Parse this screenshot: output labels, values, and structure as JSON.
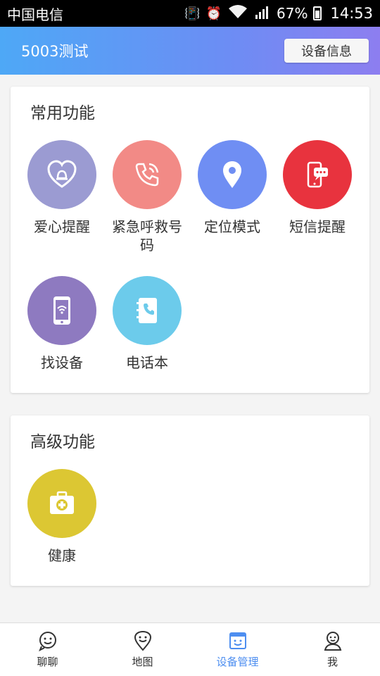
{
  "status_bar": {
    "carrier": "中国电信",
    "battery": "67%",
    "time": "14:53"
  },
  "app_bar": {
    "title": "5003测试",
    "device_info_button": "设备信息"
  },
  "common_section": {
    "title": "常用功能",
    "items": [
      {
        "label": "爱心提醒",
        "icon": "heart-bell-icon",
        "color": "#9b9bd2"
      },
      {
        "label": "紧急呼救号码",
        "icon": "phone-call-icon",
        "color": "#f28a86"
      },
      {
        "label": "定位模式",
        "icon": "location-pin-icon",
        "color": "#6f8ef3"
      },
      {
        "label": "短信提醒",
        "icon": "sms-phone-icon",
        "color": "#e8333e"
      },
      {
        "label": "找设备",
        "icon": "find-device-icon",
        "color": "#8e7ac0"
      },
      {
        "label": "电话本",
        "icon": "phonebook-icon",
        "color": "#6ccbeb"
      }
    ]
  },
  "advanced_section": {
    "title": "高级功能",
    "items": [
      {
        "label": "健康",
        "icon": "first-aid-kit-icon",
        "color": "#dcc733"
      }
    ]
  },
  "bottom_nav": {
    "items": [
      {
        "label": "聊聊",
        "icon": "chat-smile-icon"
      },
      {
        "label": "地图",
        "icon": "map-pin-smile-icon"
      },
      {
        "label": "设备管理",
        "icon": "device-manage-icon",
        "active": true
      },
      {
        "label": "我",
        "icon": "profile-icon"
      }
    ],
    "active_color": "#4d8ef0"
  }
}
